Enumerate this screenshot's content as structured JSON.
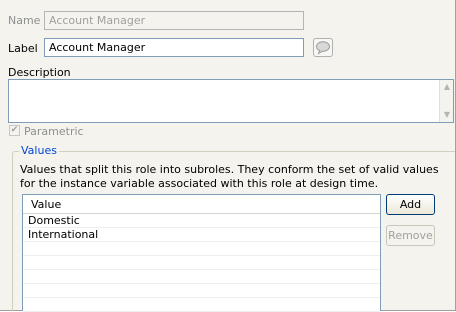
{
  "form": {
    "name_label": "Name",
    "name_value": "Account Manager",
    "label_label": "Label",
    "label_value": "Account Manager",
    "description_label": "Description",
    "description_value": "",
    "parametric_label": "Parametric",
    "parametric_checked": true
  },
  "values_group": {
    "title": "Values",
    "description": "Values that split this role into subroles. They conform the set of valid values for the instance variable associated with this role at design time.",
    "table": {
      "column_header": "Value",
      "rows": [
        "Domestic",
        "International",
        "",
        "",
        "",
        "",
        ""
      ]
    },
    "add_button": "Add",
    "remove_button": "Remove"
  },
  "icons": {
    "label_help": "speech-bubble-icon",
    "scroll_up": "arrow-up-icon",
    "scroll_down": "arrow-down-icon",
    "check": "checkmark-icon"
  },
  "colors": {
    "background": "#f4f3ee",
    "field_border": "#7f9db9",
    "group_title": "#0046d5",
    "disabled_text": "#8e8f8f"
  }
}
